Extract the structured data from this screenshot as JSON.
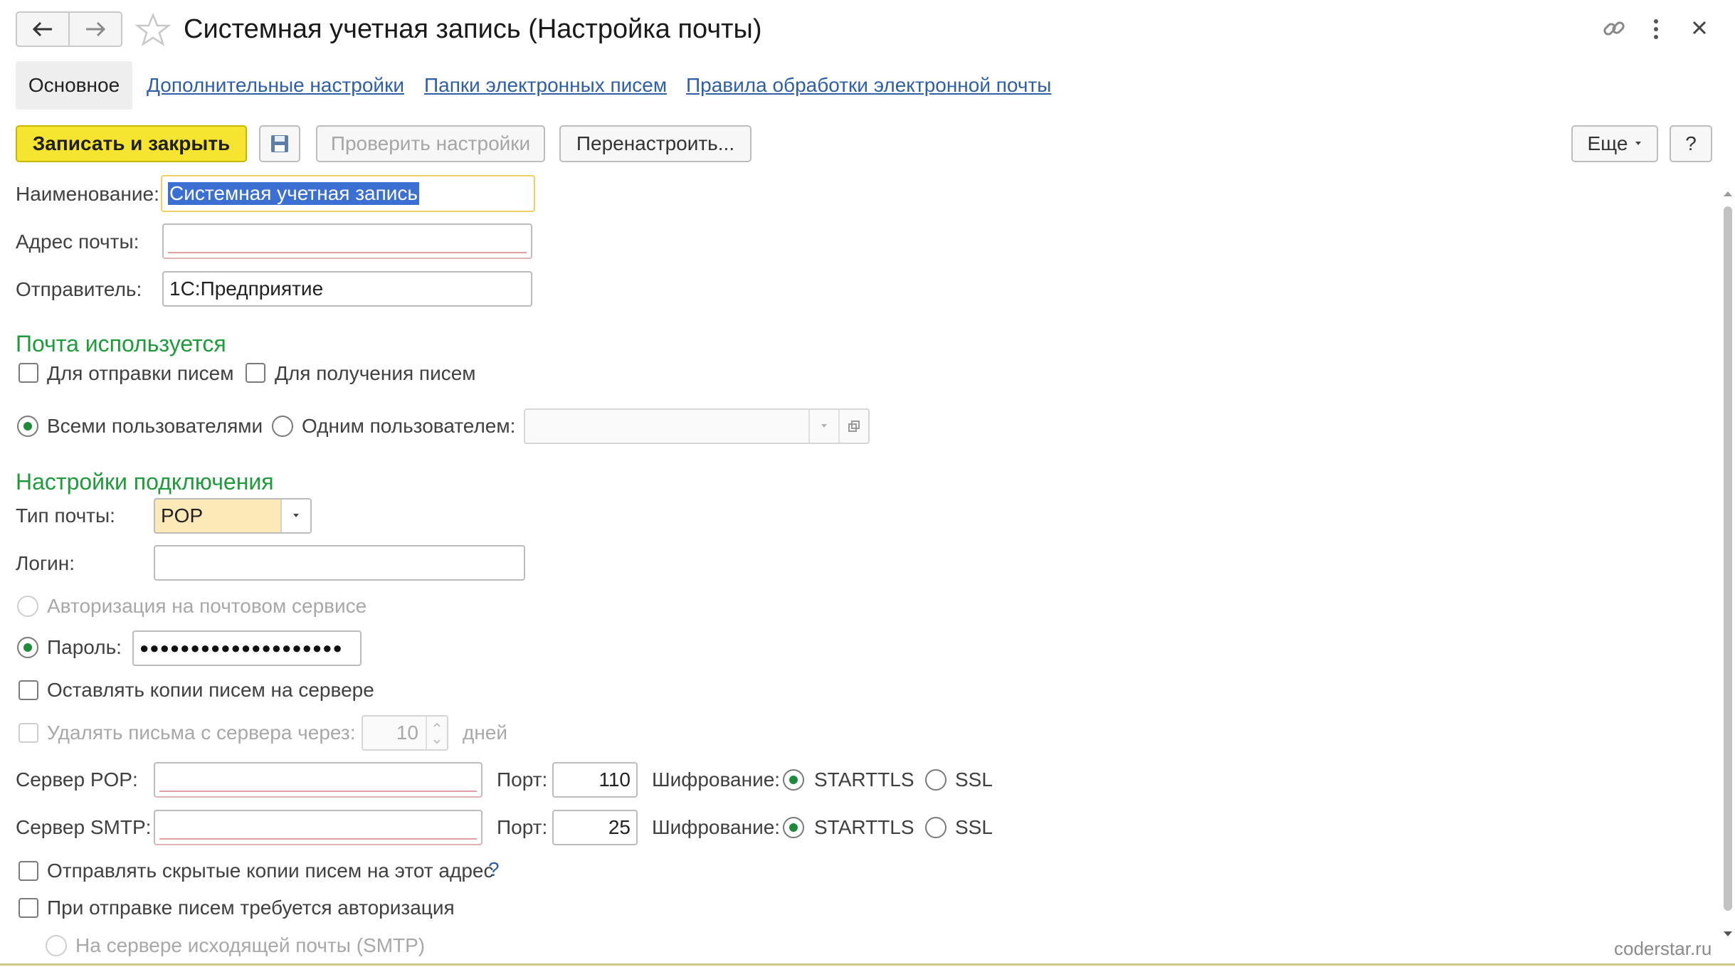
{
  "window": {
    "title": "Системная учетная запись (Настройка почты)",
    "watermark": "coderstar.ru"
  },
  "tabs": [
    {
      "label": "Основное",
      "active": true
    },
    {
      "label": "Дополнительные настройки"
    },
    {
      "label": "Папки электронных писем"
    },
    {
      "label": "Правила обработки электронной почты"
    }
  ],
  "toolbar": {
    "save_close": "Записать и закрыть",
    "check_settings": "Проверить настройки",
    "reconfigure": "Перенастроить...",
    "more": "Еще",
    "help": "?"
  },
  "fields": {
    "name_label": "Наименование:",
    "name_value": "Системная учетная запись",
    "address_label": "Адрес почты:",
    "address_value": "",
    "sender_label": "Отправитель:",
    "sender_value": "1С:Предприятие"
  },
  "usage": {
    "heading": "Почта используется",
    "send_label": "Для отправки писем",
    "receive_label": "Для получения писем",
    "all_users_label": "Всеми пользователями",
    "one_user_label": "Одним пользователем:",
    "one_user_value": ""
  },
  "connection": {
    "heading": "Настройки подключения",
    "type_label": "Тип почты:",
    "type_value": "POP",
    "login_label": "Логин:",
    "login_value": "",
    "oauth_label": "Авторизация на почтовом сервисе",
    "password_label": "Пароль:",
    "password_value": "●●●●●●●●●●●●●●●●●●●●",
    "keep_copies_label": "Оставлять копии писем на сервере",
    "delete_after_label": "Удалять письма с сервера через:",
    "delete_after_value": "10",
    "days_label": "дней",
    "pop_server_label": "Сервер POP:",
    "pop_server_value": "",
    "pop_port_label": "Порт:",
    "pop_port_value": "110",
    "pop_enc_label": "Шифрование:",
    "smtp_server_label": "Сервер SMTP:",
    "smtp_server_value": "",
    "smtp_port_label": "Порт:",
    "smtp_port_value": "25",
    "smtp_enc_label": "Шифрование:",
    "enc_starttls": "STARTTLS",
    "enc_ssl": "SSL",
    "bcc_label": "Отправлять скрытые копии писем на этот адрес",
    "bcc_help": "?",
    "auth_required_label": "При отправке писем требуется авторизация",
    "smtp_auth_label": "На сервере исходящей почты (SMTP)"
  },
  "colors": {
    "primary_button": "#f5e430",
    "section_heading": "#1e9b3a",
    "link": "#2f5fa6",
    "selection": "#3b6fd1"
  }
}
